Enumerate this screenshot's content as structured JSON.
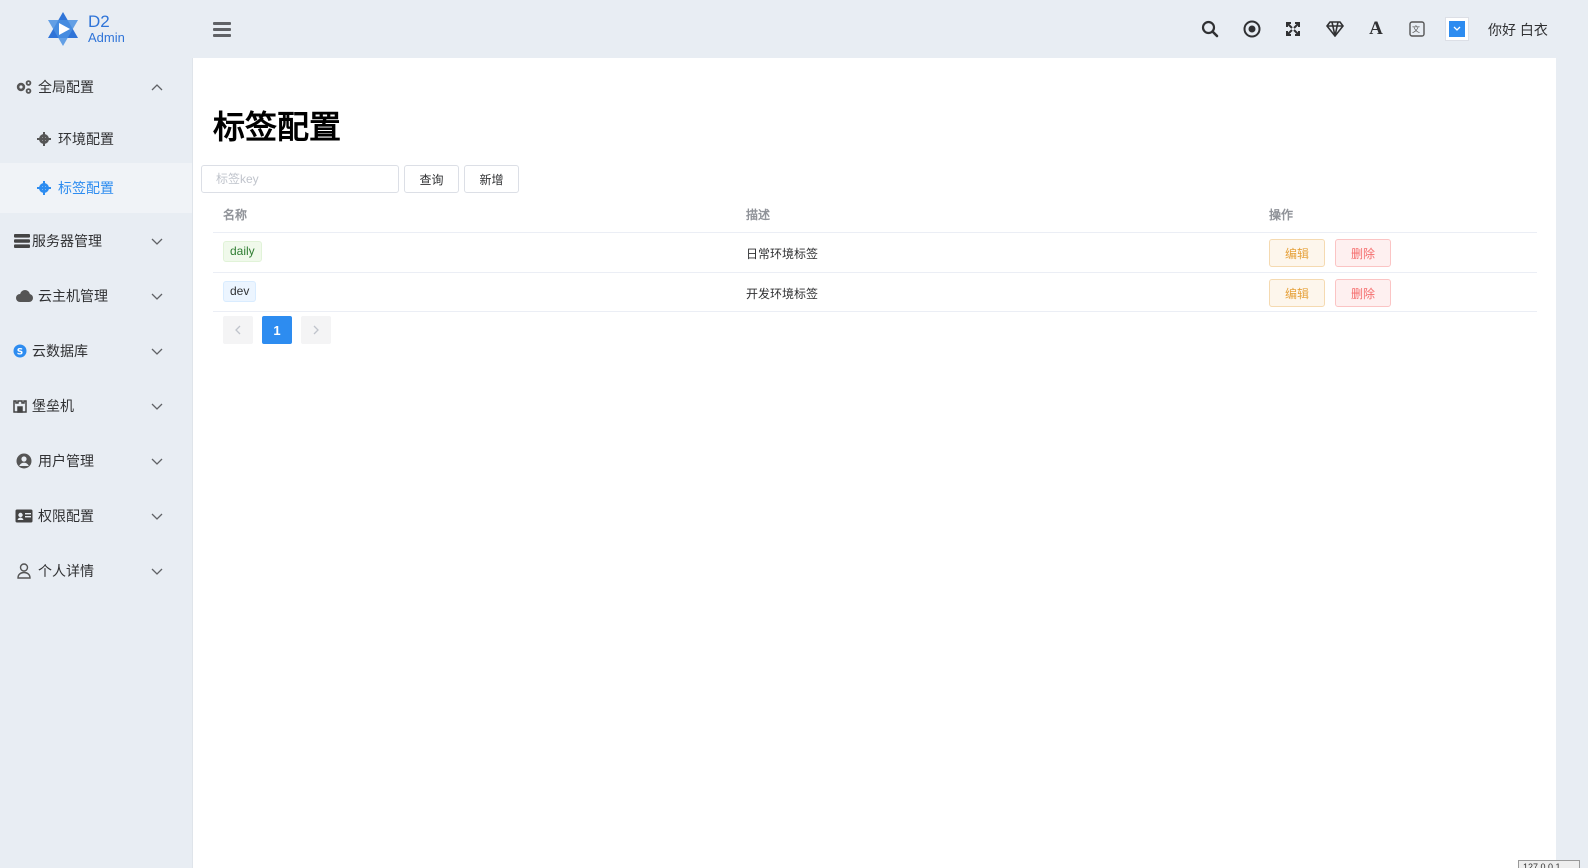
{
  "app": {
    "logo_line1": "D2",
    "logo_line2": "Admin"
  },
  "header": {
    "tools": [
      "search-icon",
      "target-icon",
      "fullscreen-icon",
      "diamond-icon",
      "font-size-icon",
      "translate-icon",
      "theme-color-icon"
    ],
    "greeting": "你好 白衣"
  },
  "sidebar": {
    "items": [
      {
        "label": "全局配置",
        "icon": "cogs-icon",
        "expanded": true,
        "children": [
          {
            "label": "环境配置",
            "icon": "gear-icon"
          },
          {
            "label": "标签配置",
            "icon": "gear-icon",
            "active": true
          }
        ]
      },
      {
        "label": "服务器管理",
        "icon": "server-icon"
      },
      {
        "label": "云主机管理",
        "icon": "cloud-icon"
      },
      {
        "label": "云数据库",
        "icon": "database-icon"
      },
      {
        "label": "堡垒机",
        "icon": "fort-icon"
      },
      {
        "label": "用户管理",
        "icon": "user-circle-icon"
      },
      {
        "label": "权限配置",
        "icon": "id-card-icon"
      },
      {
        "label": "个人详情",
        "icon": "user-icon"
      }
    ]
  },
  "main": {
    "title": "标签配置",
    "search": {
      "placeholder": "标签key",
      "value": ""
    },
    "query_label": "查询",
    "add_label": "新增",
    "columns": [
      "名称",
      "描述",
      "操作"
    ],
    "rows": [
      {
        "name": "daily",
        "desc": "日常环境标签",
        "edit": "编辑",
        "delete": "删除"
      },
      {
        "name": "dev",
        "desc": "开发环境标签",
        "edit": "编辑",
        "delete": "删除"
      }
    ],
    "pagination": {
      "current": "1"
    }
  },
  "footer": {
    "ip_text": "127.0.0.1"
  },
  "colors": {
    "primary": "#2d8cf0",
    "warning": "#e6a23c",
    "danger": "#f56c6c"
  }
}
